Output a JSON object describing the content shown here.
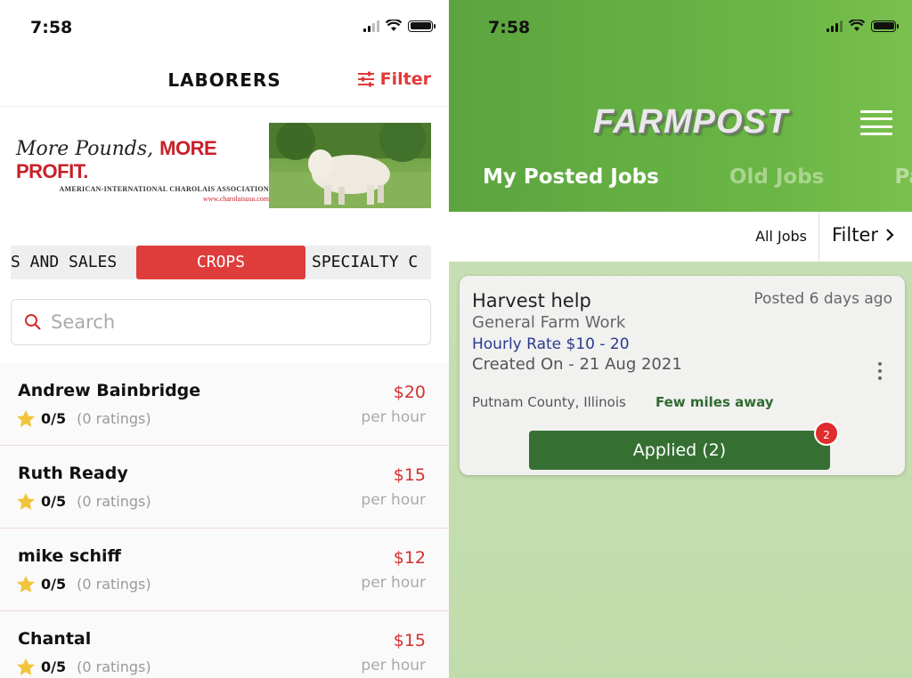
{
  "left": {
    "status": {
      "time": "7:58"
    },
    "header": {
      "title": "LABORERS",
      "filter_label": "Filter"
    },
    "ad": {
      "headline_script": "More Pounds,",
      "headline_bold": "MORE PROFIT.",
      "org": "AMERICAN-INTERNATIONAL CHAROLAIS ASSOCIATION",
      "url": "www.charolaisusa.com"
    },
    "categories": [
      "S AND SALES",
      "CROPS",
      "SPECIALTY C"
    ],
    "active_category": "CROPS",
    "search": {
      "placeholder": "Search"
    },
    "laborers": [
      {
        "name": "Andrew Bainbridge",
        "score": "0/5",
        "ratings": "(0 ratings)",
        "price": "$20",
        "unit": "per hour"
      },
      {
        "name": "Ruth Ready",
        "score": "0/5",
        "ratings": "(0 ratings)",
        "price": "$15",
        "unit": "per hour"
      },
      {
        "name": "mike schiff",
        "score": "0/5",
        "ratings": "(0 ratings)",
        "price": "$12",
        "unit": "per hour"
      },
      {
        "name": "Chantal",
        "score": "0/5",
        "ratings": "(0 ratings)",
        "price": "$15",
        "unit": "per hour"
      }
    ]
  },
  "right": {
    "status": {
      "time": "7:58"
    },
    "logo": "FARMPOST",
    "tabs": [
      "My Posted Jobs",
      "Old Jobs",
      "Pas"
    ],
    "active_tab": "My Posted Jobs",
    "subbar": {
      "all_jobs": "All Jobs",
      "filter_label": "Filter"
    },
    "job": {
      "title": "Harvest help",
      "posted": "Posted 6 days ago",
      "type": "General Farm Work",
      "rate": "Hourly Rate $10 - 20",
      "created": "Created On - 21 Aug 2021",
      "location": "Putnam County, Illinois",
      "distance": "Few miles away",
      "applied_label": "Applied (2)",
      "badge_count": "2"
    }
  },
  "colors": {
    "accent_red": "#df3c3c",
    "farm_green": "#6ab645",
    "button_green": "#357032"
  }
}
